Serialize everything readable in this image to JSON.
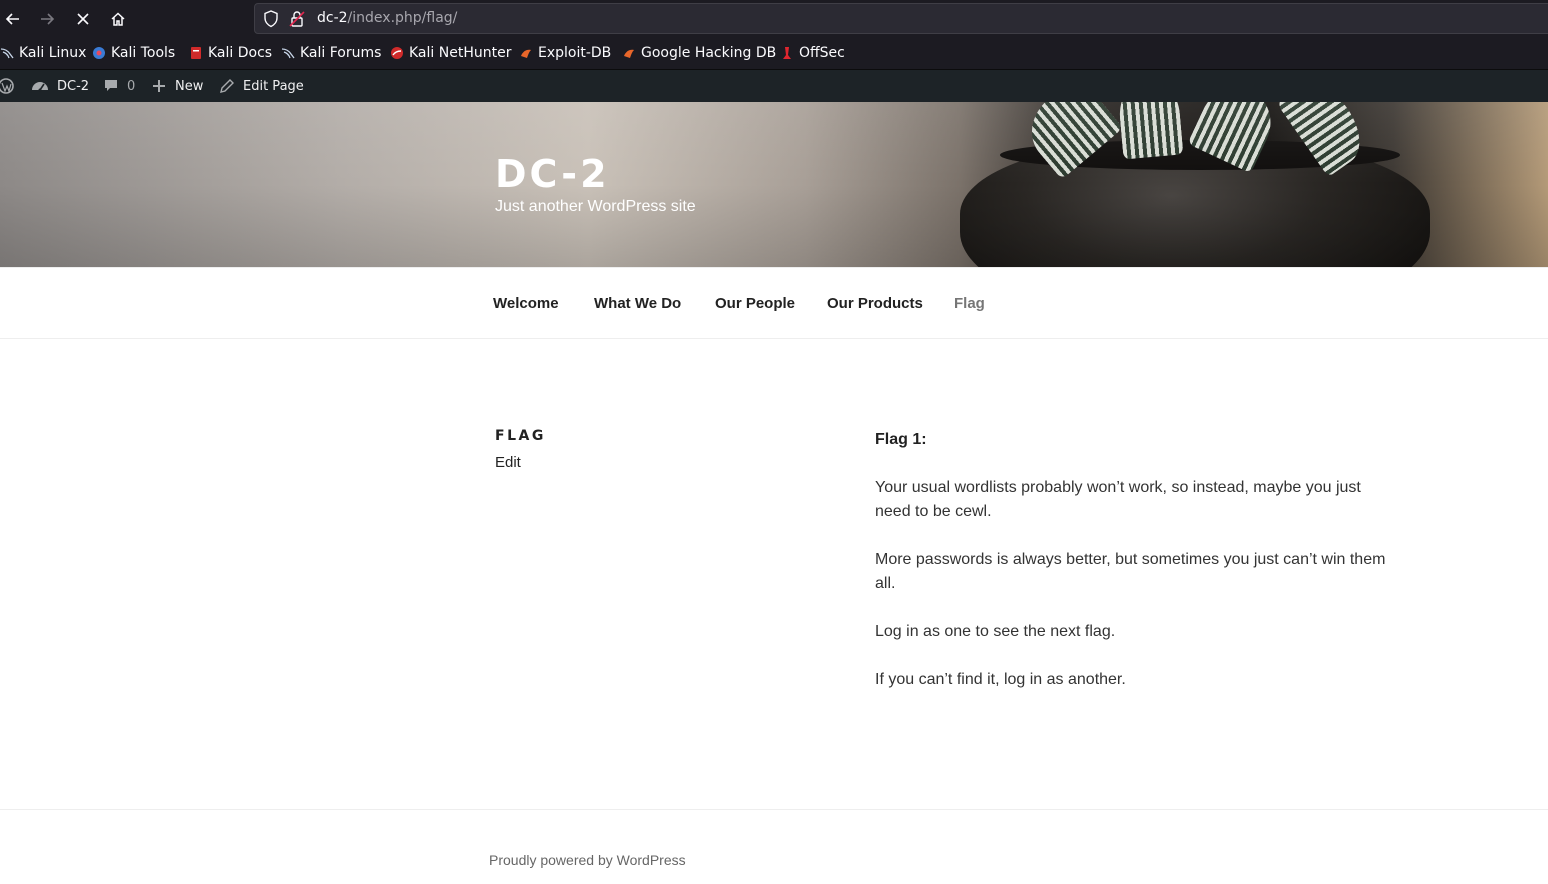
{
  "browser": {
    "url_host": "dc-2",
    "url_path": "/index.php/flag/"
  },
  "bookmarks": [
    {
      "label": "Kali Linux",
      "icon": "kali-dragon-icon",
      "color": "#8fb5e6"
    },
    {
      "label": "Kali Tools",
      "icon": "kali-tools-icon",
      "color": "#3a7bd5"
    },
    {
      "label": "Kali Docs",
      "icon": "kali-docs-icon",
      "color": "#d02a2a"
    },
    {
      "label": "Kali Forums",
      "icon": "kali-forums-icon",
      "color": "#8fb5e6"
    },
    {
      "label": "Kali NetHunter",
      "icon": "nethunter-icon",
      "color": "#d02a2a"
    },
    {
      "label": "Exploit-DB",
      "icon": "exploit-db-icon",
      "color": "#e8662a"
    },
    {
      "label": "Google Hacking DB",
      "icon": "ghdb-icon",
      "color": "#e8662a"
    },
    {
      "label": "OffSec",
      "icon": "offsec-icon",
      "color": "#e0262f"
    }
  ],
  "admin_bar": {
    "site_name": "DC-2",
    "comments_count": "0",
    "new_label": "New",
    "edit_label": "Edit Page"
  },
  "header": {
    "title": "DC-2",
    "description": "Just another WordPress site"
  },
  "nav": [
    {
      "label": "Welcome"
    },
    {
      "label": "What We Do"
    },
    {
      "label": "Our People"
    },
    {
      "label": "Our Products"
    },
    {
      "label": "Flag"
    }
  ],
  "page": {
    "title": "FLAG",
    "edit_link": "Edit",
    "heading": "Flag 1:",
    "paragraphs": [
      "Your usual wordlists probably won’t work, so instead, maybe you just need to be cewl.",
      "More passwords is always better, but sometimes you just can’t win them all.",
      "Log in as one to see the next flag.",
      "If you can’t find it, log in as another."
    ]
  },
  "footer": {
    "text": "Proudly powered by WordPress"
  }
}
